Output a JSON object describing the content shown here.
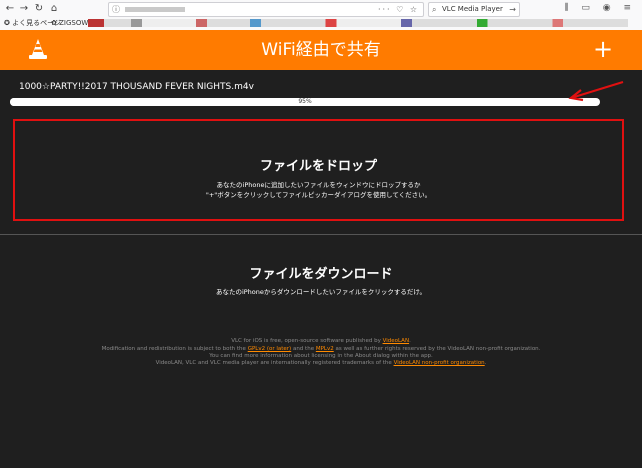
{
  "browser": {
    "search_value": "VLC Media Player",
    "bookmarks": [
      {
        "label": "よく見るページ"
      },
      {
        "label": "ZIGSOW"
      }
    ]
  },
  "header": {
    "title": "WiFi経由で共有",
    "plus": "+"
  },
  "upload": {
    "file_name": "1000☆PARTY!!2017 THOUSAND FEVER NIGHTS.m4v",
    "progress_percent": 95,
    "progress_label": "95%"
  },
  "drop": {
    "title": "ファイルをドロップ",
    "desc1": "あなたのiPhoneに追加したいファイルをウィンドウにドロップするか",
    "desc2": "\"+\"ボタンをクリックしてファイルピッカーダイアログを使用してください。"
  },
  "download": {
    "title": "ファイルをダウンロード",
    "desc": "あなたのiPhoneからダウンロードしたいファイルをクリックするだけ。"
  },
  "footer": {
    "line1_pre": "VLC for iOS is free, open-source software published by ",
    "line1_link": "VideoLAN",
    "line1_post": ".",
    "line2_pre": "Modification and redistribution is subject to both the ",
    "line2_link1": "GPLv2 (or later)",
    "line2_mid": " and the ",
    "line2_link2": "MPLv2",
    "line2_post": " as well as further rights reserved by the VideoLAN non-profit organization.",
    "line3": "You can find more information about licensing in the About dialog within the app.",
    "line4_pre": "VideoLAN, VLC and VLC media player are internationally registered trademarks of the ",
    "line4_link": "VideoLAN non-profit organization",
    "line4_post": "."
  },
  "colors": {
    "accent": "#ff7b00",
    "background": "#1f1f1f",
    "highlight": "#e01010",
    "link": "#ff8a00"
  }
}
